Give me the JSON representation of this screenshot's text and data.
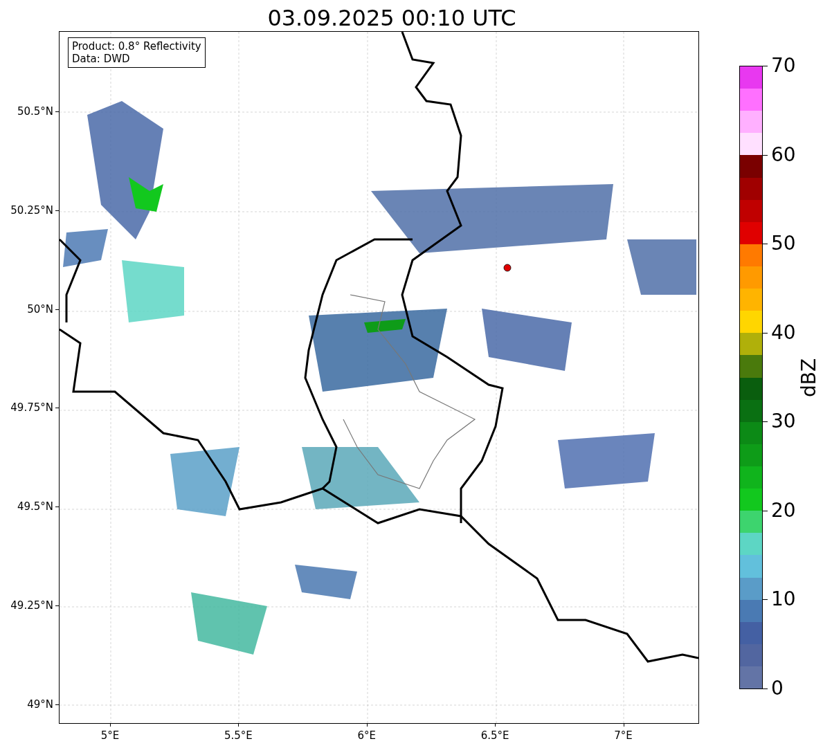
{
  "title": "03.09.2025 00:10 UTC",
  "info_box": [
    "Product: 0.8° Reflectivity",
    "Data: DWD"
  ],
  "map": {
    "xticks": [
      "5°E",
      "5.5°E",
      "6°E",
      "6.5°E",
      "7°E"
    ],
    "yticks": [
      "50.5°N",
      "50.25°N",
      "50°N",
      "49.75°N",
      "49.5°N",
      "49.25°N",
      "49°N"
    ]
  },
  "colorbar": {
    "label": "dBZ",
    "ticks": [
      "70",
      "60",
      "50",
      "40",
      "30",
      "20",
      "10",
      "0"
    ],
    "bins": [
      {
        "color": "#e838f0"
      },
      {
        "color": "#ff70ff"
      },
      {
        "color": "#ffb0ff"
      },
      {
        "color": "#ffe0ff"
      },
      {
        "color": "#7a0000"
      },
      {
        "color": "#a00000"
      },
      {
        "color": "#c00000"
      },
      {
        "color": "#e00000"
      },
      {
        "color": "#ff7a00"
      },
      {
        "color": "#ff9a00"
      },
      {
        "color": "#ffb400"
      },
      {
        "color": "#ffd600"
      },
      {
        "color": "#b0b00a"
      },
      {
        "color": "#4a7a0c"
      },
      {
        "color": "#0a5e0e"
      },
      {
        "color": "#0a7012"
      },
      {
        "color": "#0c8a16"
      },
      {
        "color": "#0e9c18"
      },
      {
        "color": "#10b41c"
      },
      {
        "color": "#12c81e"
      },
      {
        "color": "#3dd46e"
      },
      {
        "color": "#5dd6c4"
      },
      {
        "color": "#62c0dc"
      },
      {
        "color": "#5a9cc8"
      },
      {
        "color": "#4a7ab3"
      },
      {
        "color": "#4460a3"
      },
      {
        "color": "#5266a0"
      },
      {
        "color": "#6374a6"
      }
    ]
  }
}
